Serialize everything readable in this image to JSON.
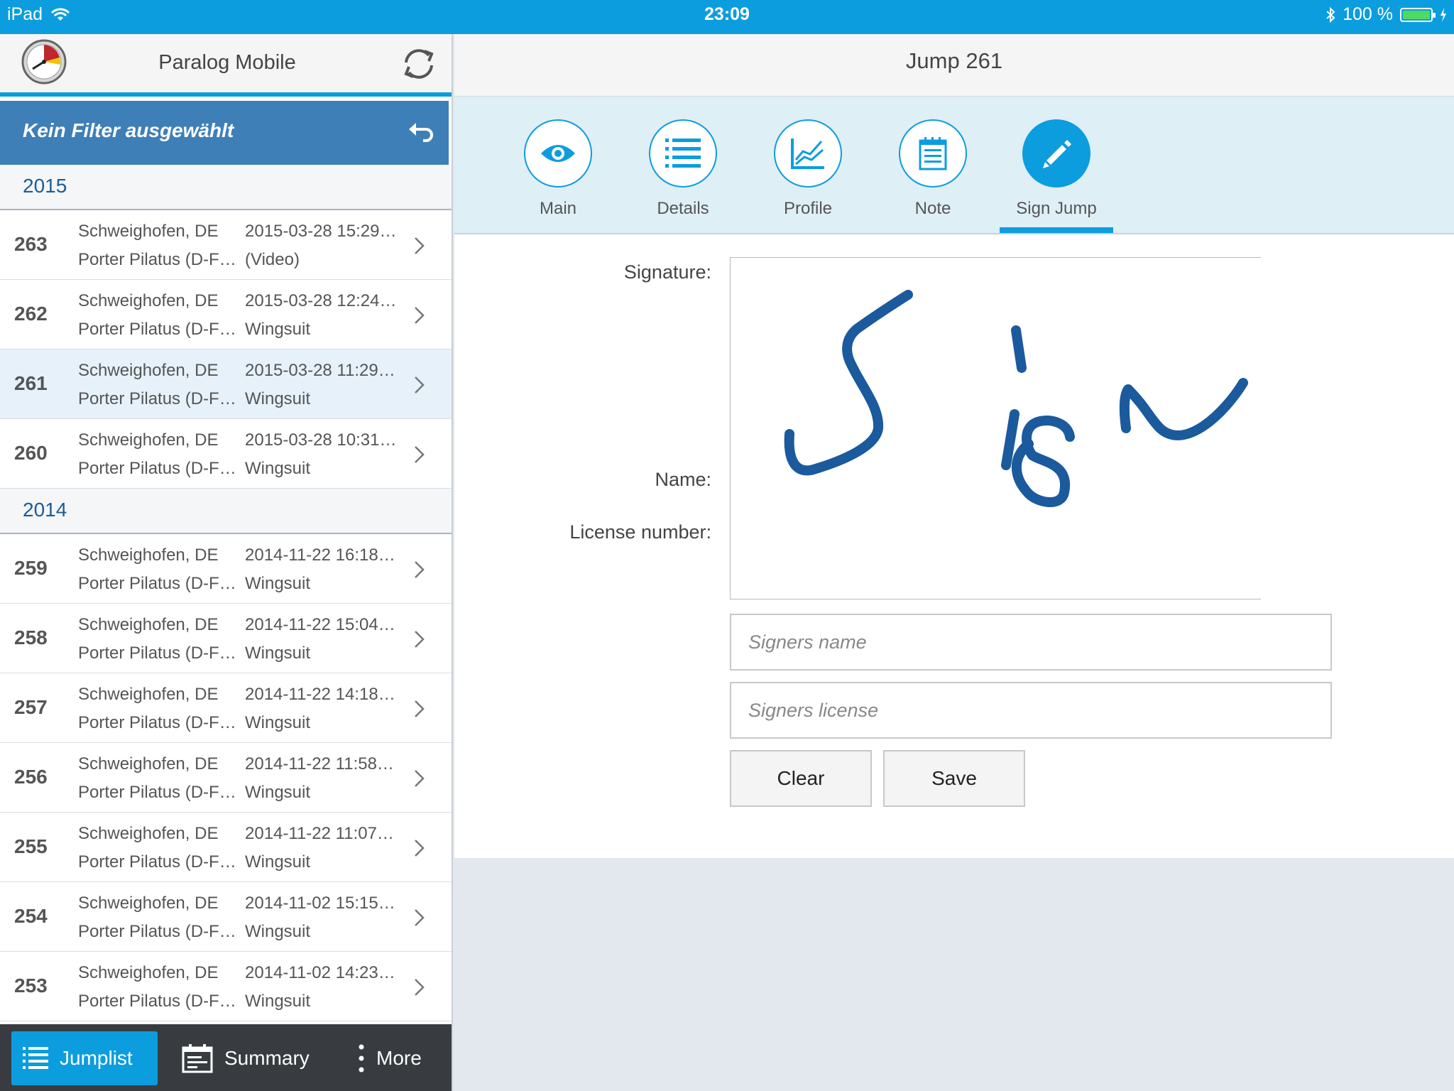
{
  "status_bar": {
    "device": "iPad",
    "time": "23:09",
    "battery": "100 %"
  },
  "left_header": {
    "title": "Paralog Mobile"
  },
  "filter": {
    "label": "Kein Filter ausgewählt"
  },
  "groups": [
    {
      "year": "2015",
      "rows": [
        {
          "num": "263",
          "place": "Schweighofen, DE",
          "plane": "Porter Pilatus (D-F…",
          "date": "2015-03-28 15:29…",
          "type": "(Video)"
        },
        {
          "num": "262",
          "place": "Schweighofen, DE",
          "plane": "Porter Pilatus (D-F…",
          "date": "2015-03-28 12:24…",
          "type": "Wingsuit"
        },
        {
          "num": "261",
          "place": "Schweighofen, DE",
          "plane": "Porter Pilatus (D-F…",
          "date": "2015-03-28 11:29…",
          "type": "Wingsuit"
        },
        {
          "num": "260",
          "place": "Schweighofen, DE",
          "plane": "Porter Pilatus (D-F…",
          "date": "2015-03-28 10:31…",
          "type": "Wingsuit"
        }
      ]
    },
    {
      "year": "2014",
      "rows": [
        {
          "num": "259",
          "place": "Schweighofen, DE",
          "plane": "Porter Pilatus (D-F…",
          "date": "2014-11-22 16:18…",
          "type": "Wingsuit"
        },
        {
          "num": "258",
          "place": "Schweighofen, DE",
          "plane": "Porter Pilatus (D-F…",
          "date": "2014-11-22 15:04…",
          "type": "Wingsuit"
        },
        {
          "num": "257",
          "place": "Schweighofen, DE",
          "plane": "Porter Pilatus (D-F…",
          "date": "2014-11-22 14:18…",
          "type": "Wingsuit"
        },
        {
          "num": "256",
          "place": "Schweighofen, DE",
          "plane": "Porter Pilatus (D-F…",
          "date": "2014-11-22 11:58…",
          "type": "Wingsuit"
        },
        {
          "num": "255",
          "place": "Schweighofen, DE",
          "plane": "Porter Pilatus (D-F…",
          "date": "2014-11-22 11:07…",
          "type": "Wingsuit"
        },
        {
          "num": "254",
          "place": "Schweighofen, DE",
          "plane": "Porter Pilatus (D-F…",
          "date": "2014-11-02 15:15…",
          "type": "Wingsuit"
        },
        {
          "num": "253",
          "place": "Schweighofen, DE",
          "plane": "Porter Pilatus (D-F…",
          "date": "2014-11-02 14:23…",
          "type": "Wingsuit"
        }
      ]
    }
  ],
  "tabbar": {
    "jumplist": "Jumplist",
    "summary": "Summary",
    "more": "More"
  },
  "right_header": {
    "title": "Jump 261"
  },
  "segments": {
    "main": "Main",
    "details": "Details",
    "profile": "Profile",
    "note": "Note",
    "sign": "Sign Jump"
  },
  "form": {
    "signature_label": "Signature:",
    "name_label": "Name:",
    "name_placeholder": "Signers name",
    "license_label": "License number:",
    "license_placeholder": "Signers license",
    "clear": "Clear",
    "save": "Save"
  },
  "colors": {
    "accent": "#0c9ddf",
    "filter_bg": "#3e7fb8",
    "ink": "#1b5a9c",
    "tabbar_bg": "#383c40"
  }
}
